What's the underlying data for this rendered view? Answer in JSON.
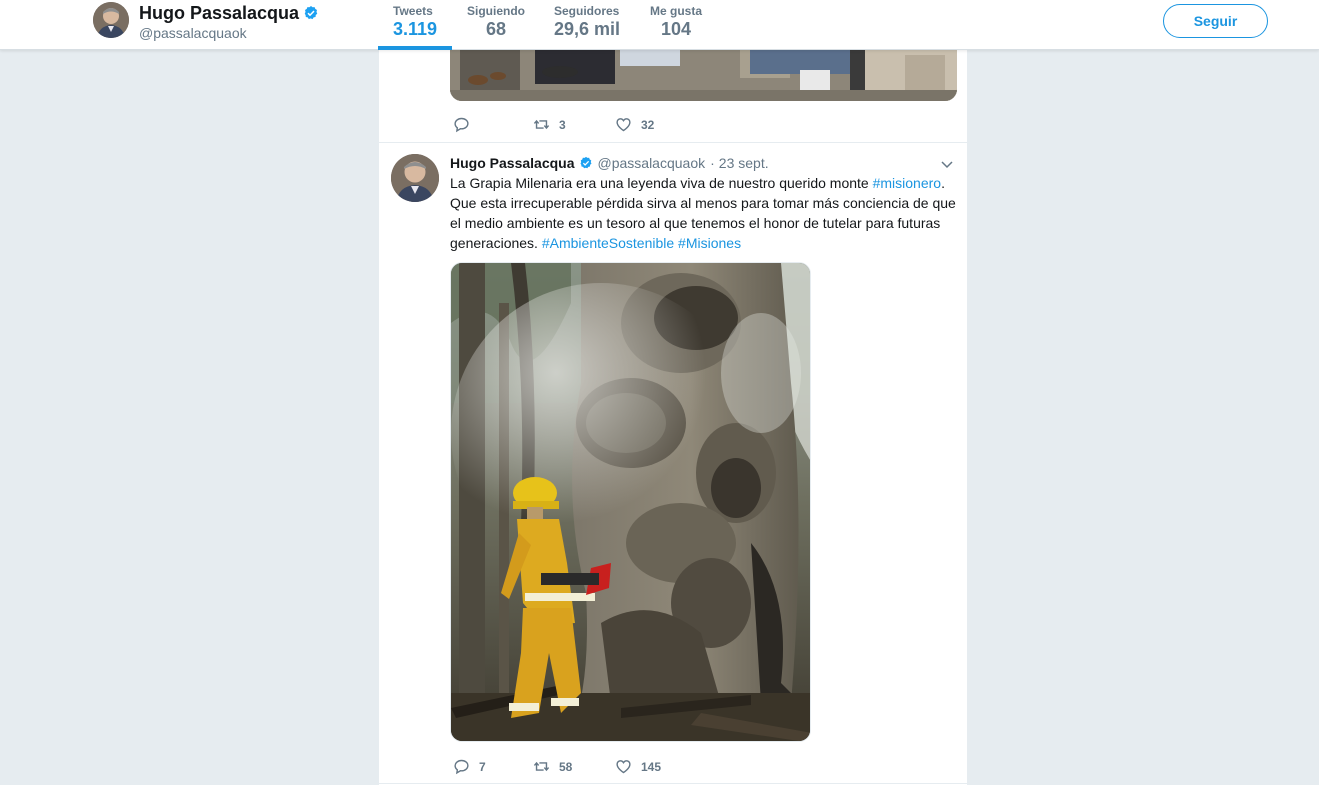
{
  "profile": {
    "name": "Hugo Passalacqua",
    "handle": "@passalacquaok",
    "verified": true
  },
  "nav": {
    "stats": [
      {
        "label": "Tweets",
        "value": "3.119",
        "active": true
      },
      {
        "label": "Siguiendo",
        "value": "68",
        "active": false
      },
      {
        "label": "Seguidores",
        "value": "29,6 mil",
        "active": false
      },
      {
        "label": "Me gusta",
        "value": "104",
        "active": false
      }
    ],
    "follow_label": "Seguir"
  },
  "previous_tweet": {
    "actions": {
      "reply_count": "",
      "retweet_count": "3",
      "like_count": "32"
    }
  },
  "tweet": {
    "fullname": "Hugo Passalacqua",
    "handle": "@passalacquaok",
    "separator": "·",
    "time": "23 sept.",
    "text_before": "La Grapia Milenaria era una leyenda viva de nuestro querido monte ",
    "hashtag_1": "#misionero",
    "text_middle": ". Que esta irrecuperable pérdida sirva al menos para tomar más conciencia de que el medio ambiente es un tesoro al que tenemos el honor de tutelar para futuras generaciones. ",
    "hashtag_2": "#AmbienteSostenible",
    "hashtag_3": "#Misiones",
    "actions": {
      "reply_count": "7",
      "retweet_count": "58",
      "like_count": "145"
    }
  },
  "colors": {
    "accent": "#1b95e0",
    "verified_badge": "#1da1f2",
    "background": "#e6ecf0",
    "muted_text": "#657786"
  },
  "icons": [
    "verified-badge-icon",
    "reply-icon",
    "retweet-icon",
    "like-icon",
    "chevron-down-icon"
  ]
}
